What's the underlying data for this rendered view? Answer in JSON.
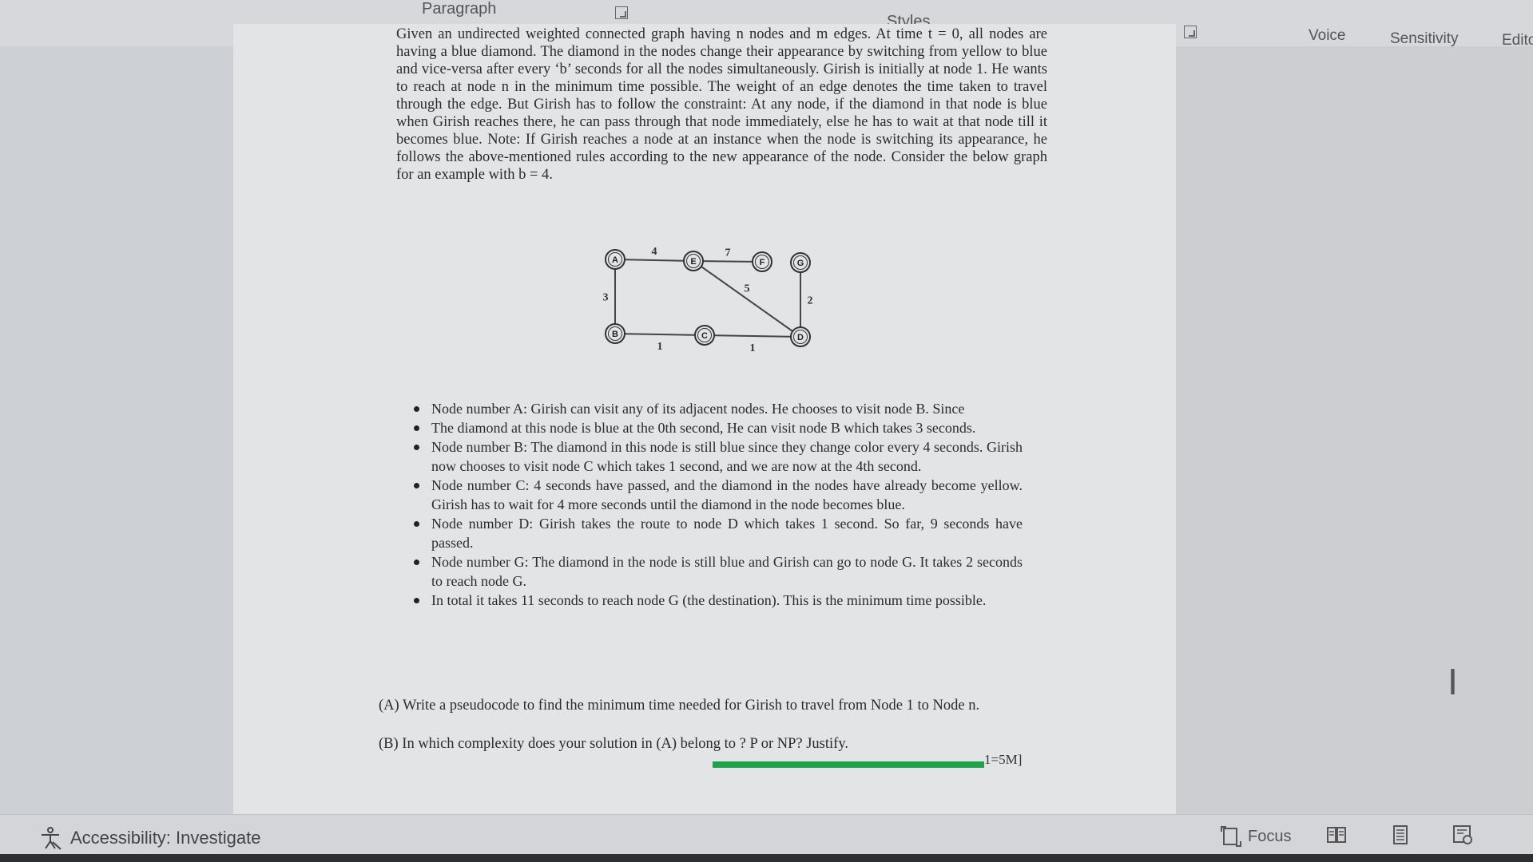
{
  "ribbon": {
    "paragraph_label": "Paragraph",
    "styles_label": "Styles",
    "voice_label": "Voice",
    "sensitivity_label": "Sensitivity",
    "editor_label": "Edito"
  },
  "document": {
    "intro": "Given an undirected weighted connected graph having n nodes and m edges. At time t = 0, all nodes are having a blue diamond. The diamond in the nodes change their appearance by switching from yellow to blue and vice-versa after every ‘b’ seconds for all the nodes simultaneously. Girish is initially at node 1. He wants to reach at node n in the minimum time possible. The weight of an edge denotes the time taken to travel through the edge. But Girish has to follow the constraint: At any node, if the diamond in that node is blue when Girish reaches there, he can pass through that node immediately, else he has to wait at that node till it becomes blue. Note: If Girish reaches a node at an instance when the node is switching its appearance, he follows the above-mentioned rules according to the new appearance of the node. Consider the below graph for an example with b = 4.",
    "bullets": [
      "Node number A: Girish can visit any of its adjacent nodes. He chooses to visit node B. Since",
      "The diamond at this node is blue at the 0th second, He can visit node B which takes 3 seconds.",
      "Node number B: The diamond in this node is still blue since they change color every 4 seconds. Girish now chooses to visit node C which takes 1 second, and we are now at the 4th second.",
      "Node number C: 4 seconds have passed, and the diamond in the nodes have already become yellow. Girish has to wait for 4 more seconds until the diamond in the node becomes blue.",
      "Node number D: Girish takes the route to node D which takes 1 second. So far, 9 seconds have passed.",
      "Node number G: The diamond in the node is still blue and Girish can go to node G. It takes 2 seconds to reach node G.",
      "In total it takes 11 seconds to reach node G (the destination). This is the minimum time possible."
    ],
    "question_a": "(A) Write a pseudocode to find the minimum time needed for Girish to travel from Node 1 to Node n.",
    "question_b": "(B) In which complexity does your solution in (A) belong to ? P or NP? Justify.",
    "marks_label": "1=5M]"
  },
  "graph": {
    "nodes": [
      {
        "id": "A"
      },
      {
        "id": "E"
      },
      {
        "id": "F"
      },
      {
        "id": "G"
      },
      {
        "id": "B"
      },
      {
        "id": "C"
      },
      {
        "id": "D"
      }
    ],
    "edges": [
      {
        "from": "A",
        "to": "E",
        "weight": "4"
      },
      {
        "from": "E",
        "to": "F",
        "weight": "7"
      },
      {
        "from": "A",
        "to": "B",
        "weight": "3"
      },
      {
        "from": "E",
        "to": "D",
        "weight": "5"
      },
      {
        "from": "G",
        "to": "D",
        "weight": "2"
      },
      {
        "from": "B",
        "to": "C",
        "weight": "1"
      },
      {
        "from": "C",
        "to": "D",
        "weight": "1"
      }
    ]
  },
  "statusbar": {
    "accessibility_label": "Accessibility: Investigate",
    "focus_label": "Focus"
  },
  "colors": {
    "progress": "#1fa14a",
    "page": "#e3e4e6",
    "background": "#c9ccd1"
  }
}
